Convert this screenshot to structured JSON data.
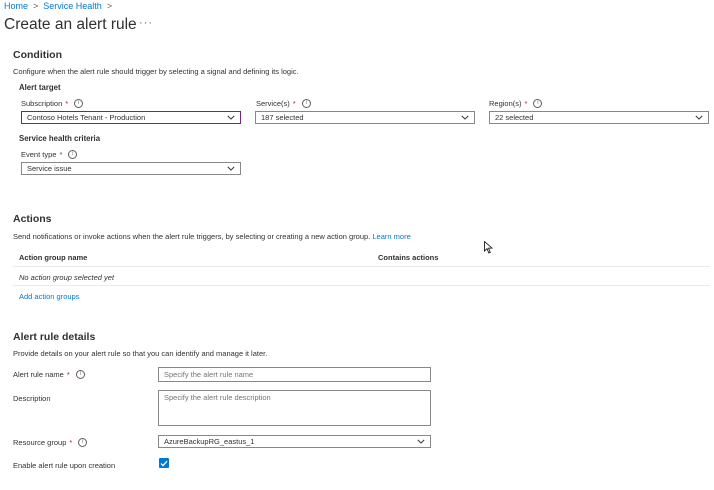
{
  "breadcrumb": {
    "items": [
      "Home",
      "Service Health"
    ]
  },
  "page": {
    "title": "Create an alert rule",
    "more": "···"
  },
  "condition": {
    "heading": "Condition",
    "description": "Configure when the alert rule should trigger by selecting a signal and defining its logic.",
    "alert_target": "Alert target",
    "subscription": {
      "label": "Subscription",
      "value": "Contoso Hotels Tenant - Production"
    },
    "services": {
      "label": "Service(s)",
      "value": "187 selected"
    },
    "regions": {
      "label": "Region(s)",
      "value": "22 selected"
    },
    "criteria_heading": "Service health criteria",
    "event_type": {
      "label": "Event type",
      "value": "Service issue"
    }
  },
  "actions": {
    "heading": "Actions",
    "description": "Send notifications or invoke actions when the alert rule triggers, by selecting or creating a new action group.",
    "learn_more": "Learn more",
    "columns": [
      "Action group name",
      "Contains actions"
    ],
    "empty_text": "No action group selected yet",
    "add_link": "Add action groups"
  },
  "details": {
    "heading": "Alert rule details",
    "description": "Provide details on your alert rule so that you can identify and manage it later.",
    "name": {
      "label": "Alert rule name",
      "placeholder": "Specify the alert rule name"
    },
    "desc": {
      "label": "Description",
      "placeholder": "Specify the alert rule description"
    },
    "resource_group": {
      "label": "Resource group",
      "value": "AzureBackupRG_eastus_1"
    },
    "enable": {
      "label": "Enable alert rule upon creation",
      "checked": true
    }
  },
  "glyphs": {
    "required": "*",
    "info": "i",
    "chevron_right": ">"
  },
  "colors": {
    "accent": "#0078d4",
    "focus_border": "#7a1f8a",
    "required": "#a4262c"
  }
}
